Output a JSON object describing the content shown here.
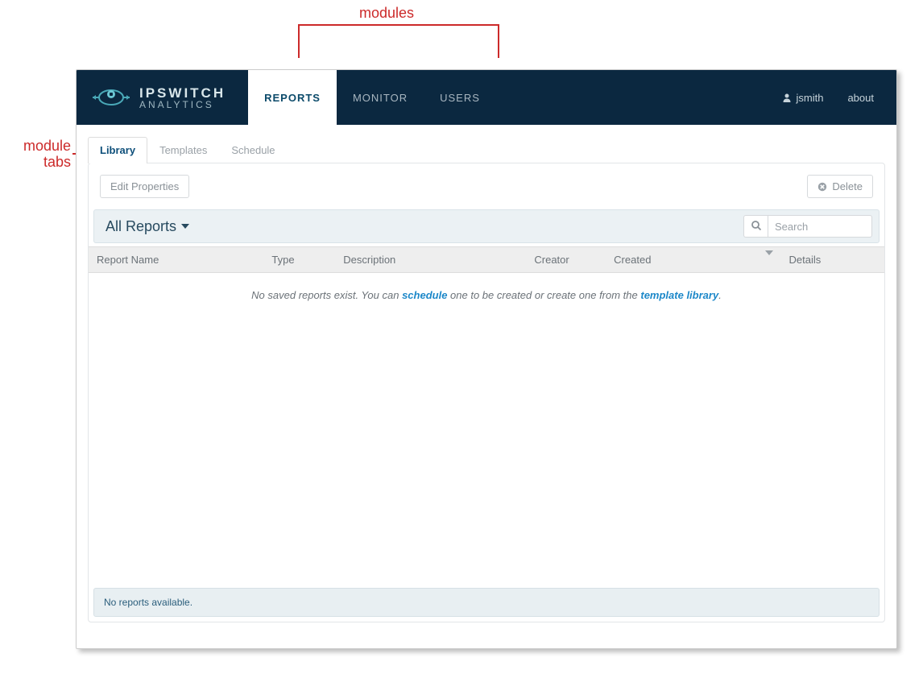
{
  "annotations": {
    "modules": "modules",
    "module_tabs_line1": "module",
    "module_tabs_line2": "tabs"
  },
  "brand": {
    "name": "IPSWITCH",
    "sub": "ANALYTICS"
  },
  "modules": [
    {
      "label": "REPORTS",
      "active": true
    },
    {
      "label": "MONITOR",
      "active": false
    },
    {
      "label": "USERS",
      "active": false
    }
  ],
  "header": {
    "username": "jsmith",
    "about": "about"
  },
  "subtabs": [
    {
      "label": "Library",
      "active": true
    },
    {
      "label": "Templates",
      "active": false
    },
    {
      "label": "Schedule",
      "active": false
    }
  ],
  "toolbar": {
    "edit_properties": "Edit Properties",
    "delete": "Delete"
  },
  "filter": {
    "title": "All Reports",
    "search_placeholder": "Search"
  },
  "columns": [
    "Report Name",
    "Type",
    "Description",
    "Creator",
    "Created",
    "Details"
  ],
  "sorted_column_index": 4,
  "empty": {
    "pre": "No saved reports exist. You can ",
    "link1": "schedule",
    "mid": " one to be created or create one from the ",
    "link2": "template library",
    "post": "."
  },
  "footer": "No reports available."
}
